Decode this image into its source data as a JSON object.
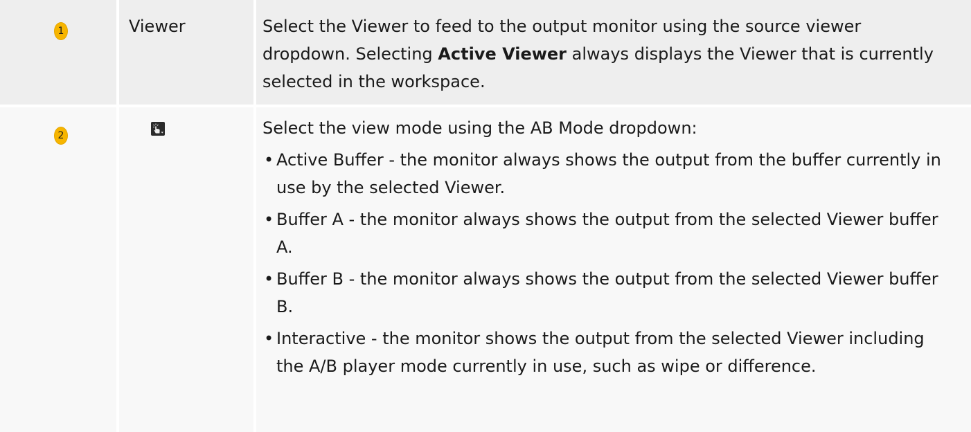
{
  "rows": [
    {
      "number": "1",
      "label": "Viewer",
      "description": {
        "before": "Select the Viewer to feed to the output monitor using the source viewer dropdown. Selecting ",
        "bold": "Active Viewer",
        "after": " always displays the Viewer that is currently selected in the workspace."
      }
    },
    {
      "number": "2",
      "icon": "ab-mode-pointer-icon",
      "intro": "Select the view mode using the AB Mode dropdown:",
      "bullet_char": "•",
      "bullets": [
        "Active Buffer - the monitor always shows the output from the buffer currently in use by the selected Viewer.",
        "Buffer A - the monitor always shows the output from the selected Viewer buffer A.",
        "Buffer B - the monitor always shows the output from the selected Viewer buffer B.",
        "Interactive - the monitor shows the output from the selected Viewer including the A/B player mode currently in use, such as wipe or difference."
      ]
    }
  ],
  "colors": {
    "row1_bg": "#eeeeee",
    "row2_bg": "#f8f8f8",
    "badge": "#f7b500",
    "icon_bg": "#2b2b2b"
  }
}
